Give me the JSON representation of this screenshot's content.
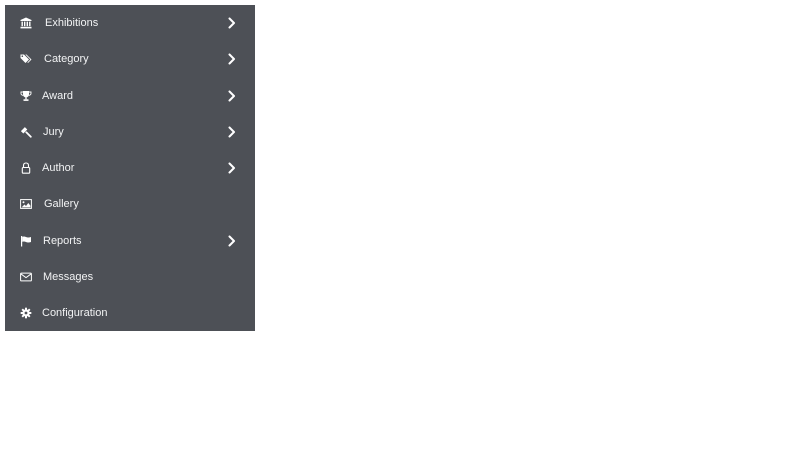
{
  "sidebar": {
    "background": "#4d5056",
    "items": [
      {
        "label": "Exhibitions",
        "icon": "bank-icon",
        "has_submenu": true
      },
      {
        "label": "Category",
        "icon": "tags-icon",
        "has_submenu": true
      },
      {
        "label": "Award",
        "icon": "trophy-icon",
        "has_submenu": true
      },
      {
        "label": "Jury",
        "icon": "gavel-icon",
        "has_submenu": true
      },
      {
        "label": "Author",
        "icon": "lock-icon",
        "has_submenu": true
      },
      {
        "label": "Gallery",
        "icon": "image-icon",
        "has_submenu": false
      },
      {
        "label": "Reports",
        "icon": "flag-icon",
        "has_submenu": true
      },
      {
        "label": "Messages",
        "icon": "envelope-icon",
        "has_submenu": false
      },
      {
        "label": "Configuration",
        "icon": "gear-icon",
        "has_submenu": false
      }
    ]
  }
}
